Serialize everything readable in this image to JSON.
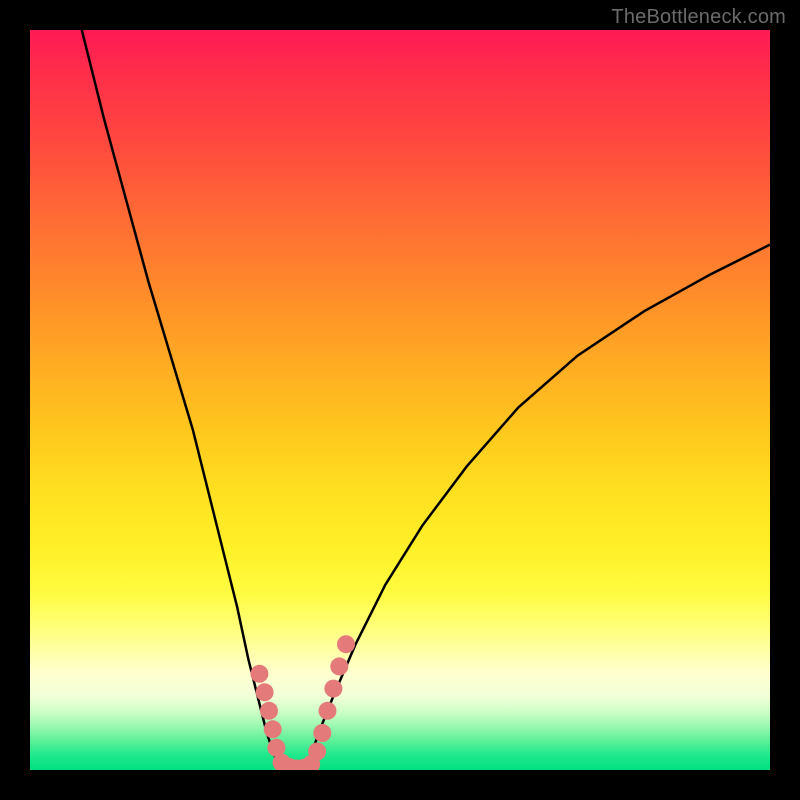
{
  "watermark": "TheBottleneck.com",
  "chart_data": {
    "type": "line",
    "title": "",
    "xlabel": "",
    "ylabel": "",
    "xlim": [
      0,
      100
    ],
    "ylim": [
      0,
      100
    ],
    "grid": false,
    "legend": false,
    "note": "Bottleneck-style V-curve with gradient background; values estimated from pixel positions (0=bottom/left, 100=top/right).",
    "series": [
      {
        "name": "left-curve",
        "x": [
          7,
          10,
          13,
          16,
          19,
          22,
          24,
          26,
          28,
          29.5,
          31,
          32,
          33,
          34
        ],
        "values": [
          100,
          88,
          77,
          66,
          56,
          46,
          38,
          30,
          22,
          15,
          9,
          5,
          2,
          0
        ]
      },
      {
        "name": "right-curve",
        "x": [
          37,
          38,
          39,
          41,
          44,
          48,
          53,
          59,
          66,
          74,
          83,
          92,
          100
        ],
        "values": [
          0,
          2,
          5,
          10,
          17,
          25,
          33,
          41,
          49,
          56,
          62,
          67,
          71
        ]
      }
    ],
    "markers": {
      "name": "highlight-dots",
      "color": "#e57a7a",
      "points": [
        {
          "x": 31.0,
          "y": 13.0
        },
        {
          "x": 31.7,
          "y": 10.5
        },
        {
          "x": 32.3,
          "y": 8.0
        },
        {
          "x": 32.8,
          "y": 5.5
        },
        {
          "x": 33.3,
          "y": 3.0
        },
        {
          "x": 34.0,
          "y": 1.0
        },
        {
          "x": 35.0,
          "y": 0.4
        },
        {
          "x": 36.0,
          "y": 0.2
        },
        {
          "x": 37.0,
          "y": 0.3
        },
        {
          "x": 38.0,
          "y": 0.8
        },
        {
          "x": 38.8,
          "y": 2.5
        },
        {
          "x": 39.5,
          "y": 5.0
        },
        {
          "x": 40.2,
          "y": 8.0
        },
        {
          "x": 41.0,
          "y": 11.0
        },
        {
          "x": 41.8,
          "y": 14.0
        },
        {
          "x": 42.7,
          "y": 17.0
        }
      ]
    },
    "gradient_stops": [
      {
        "pos": 0,
        "color": "#ff1a55"
      },
      {
        "pos": 50,
        "color": "#ffc71e"
      },
      {
        "pos": 80,
        "color": "#ffff70"
      },
      {
        "pos": 100,
        "color": "#00e080"
      }
    ]
  }
}
